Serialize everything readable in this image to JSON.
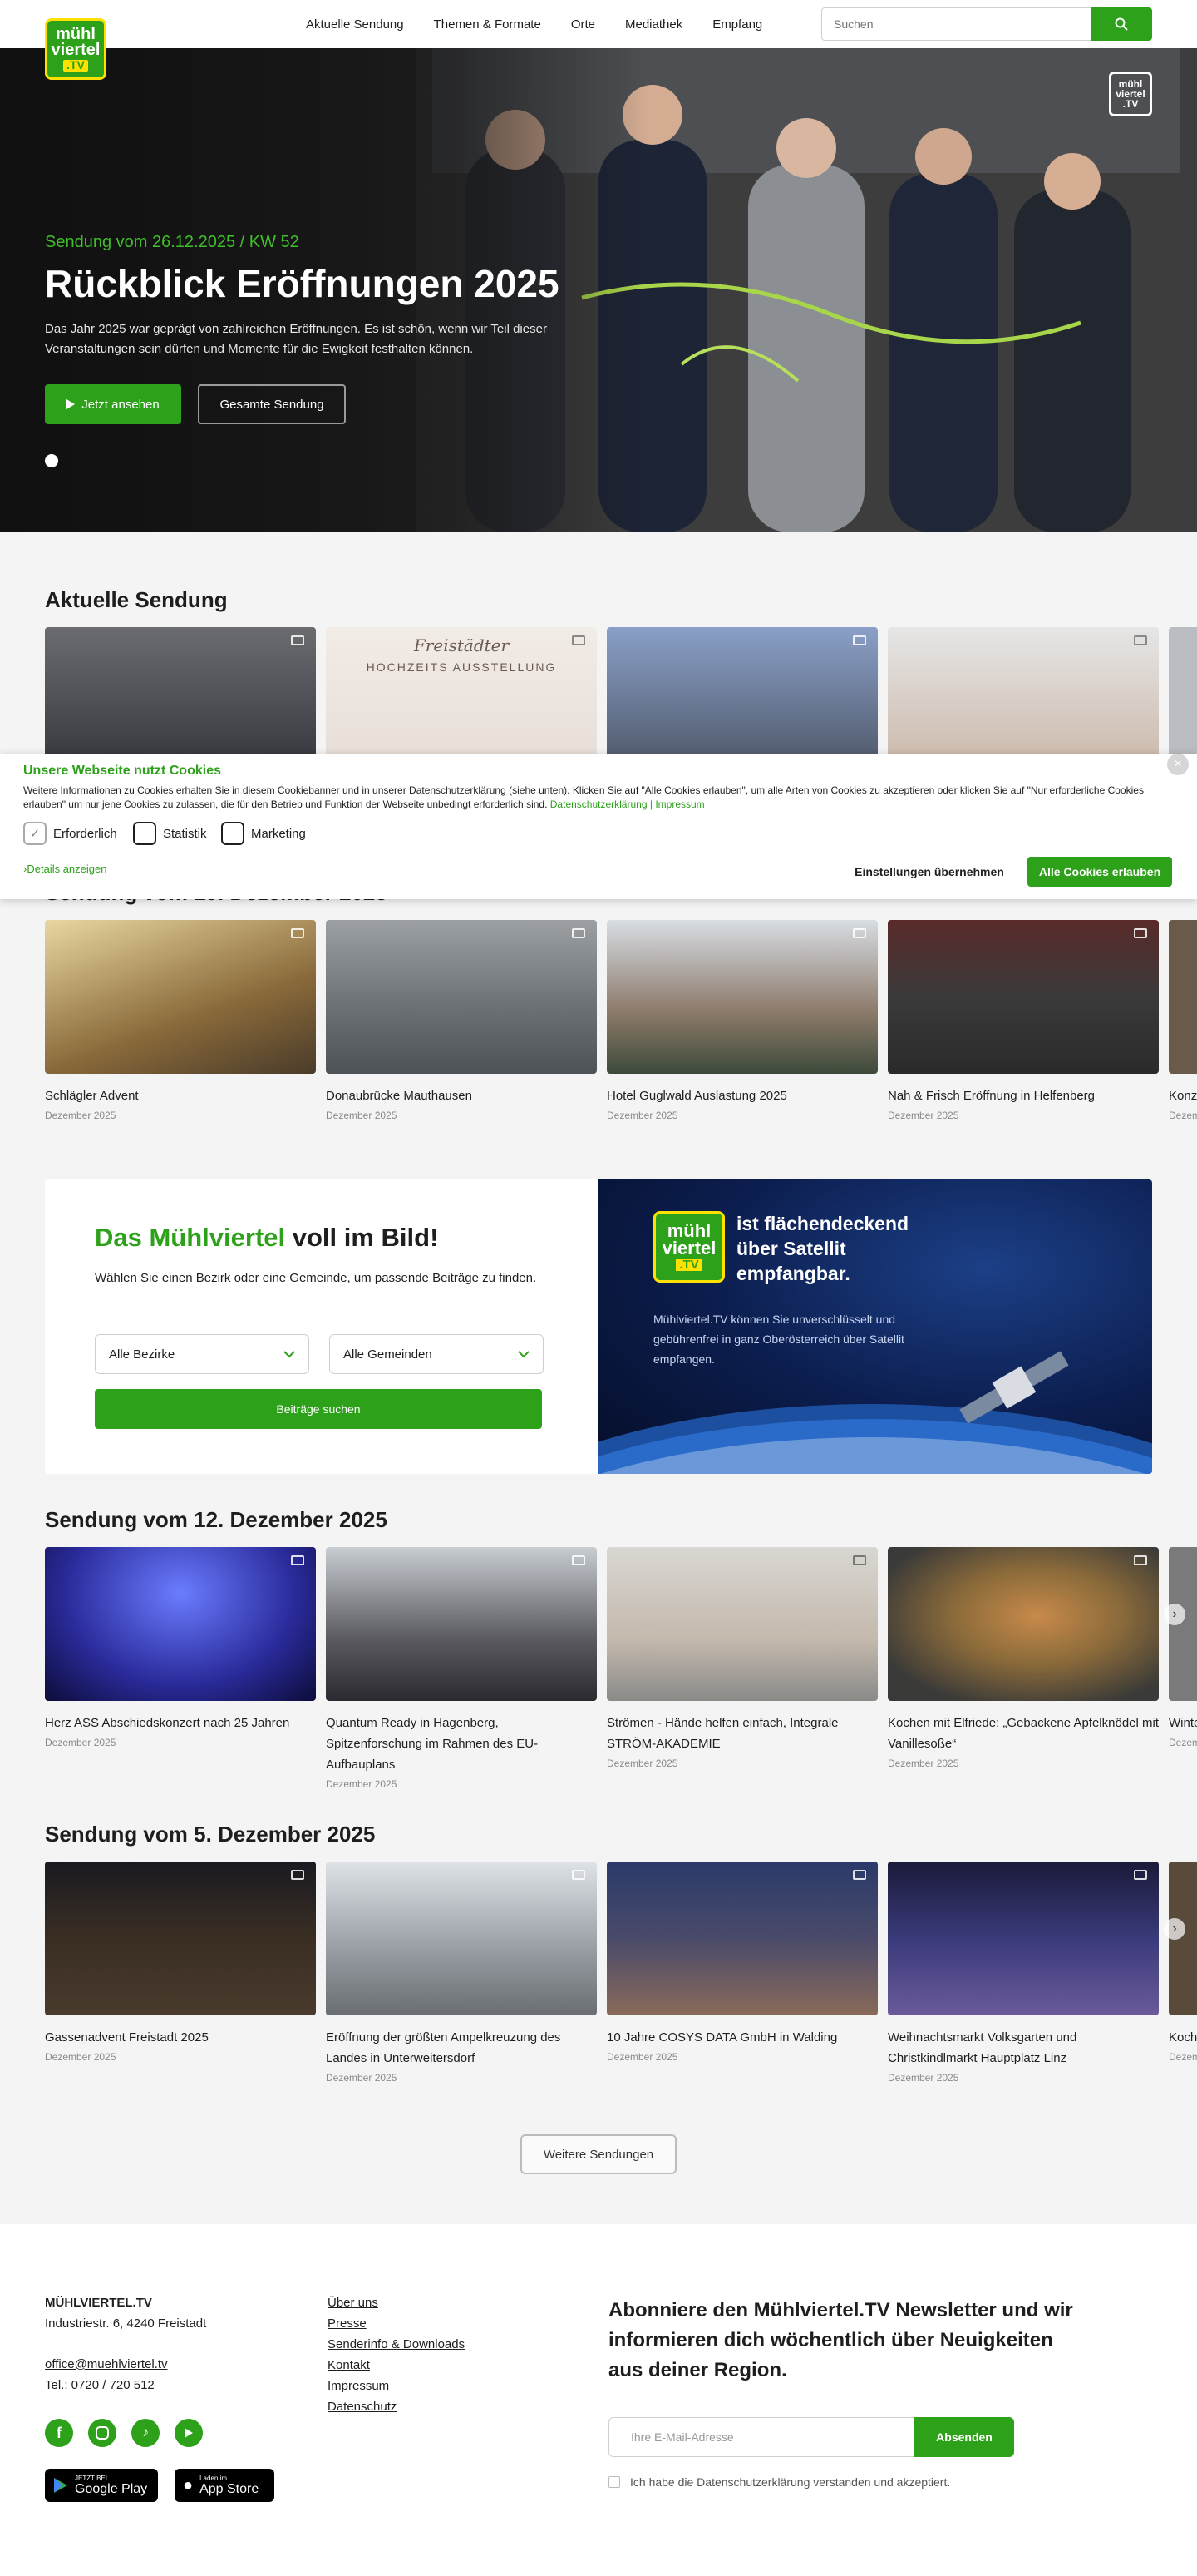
{
  "header": {
    "logo": {
      "line1": "mühl",
      "line2": "viertel",
      "line3": ".TV"
    },
    "nav": [
      "Aktuelle Sendung",
      "Themen & Formate",
      "Orte",
      "Mediathek",
      "Empfang"
    ],
    "search_placeholder": "Suchen"
  },
  "hero": {
    "kicker": "Sendung vom 26.12.2025 / KW 52",
    "title": "Rückblick Eröffnungen 2025",
    "text": "Das Jahr 2025 war geprägt von zahlreichen Eröffnungen. Es ist schön, wenn wir Teil dieser Veranstaltungen sein dürfen und Momente für die Ewigkeit festhalten können.",
    "btn_watch": "Jetzt ansehen",
    "btn_full": "Gesamte Sendung",
    "badge": {
      "line1": "mühl",
      "line2": "viertel",
      "line3": ".TV"
    }
  },
  "current": {
    "title": "Aktuelle Sendung",
    "thumb_text": {
      "line1": "Freistädter",
      "line2": "HOCHZEITS AUSSTELLUNG"
    }
  },
  "cookie": {
    "title": "Unsere Webseite nutzt Cookies",
    "text": "Weitere Informationen zu Cookies erhalten Sie in diesem Cookiebanner und in unserer Datenschutzerklärung (siehe unten). Klicken Sie auf \"Alle Cookies erlauben\", um alle Arten von Cookies zu akzeptieren oder klicken Sie auf \"Nur erforderliche Cookies erlauben\" um nur jene Cookies zu zulassen, die für den Betrieb und Funktion der Webseite unbedingt erforderlich sind.",
    "link_privacy": "Datenschutzerklärung",
    "link_sep": "|",
    "link_imprint": "Impressum",
    "options": [
      "Erforderlich",
      "Statistik",
      "Marketing"
    ],
    "details": "Details anzeigen",
    "save": "Einstellungen übernehmen",
    "allow_all": "Alle Cookies erlauben",
    "close": "×"
  },
  "section1": {
    "title": "Sendung vom 19. Dezember 2025",
    "items": [
      {
        "title": "Schlägler Advent",
        "date": "Dezember 2025"
      },
      {
        "title": "Donaubrücke Mauthausen",
        "date": "Dezember 2025"
      },
      {
        "title": "Hotel Guglwald Auslastung 2025",
        "date": "Dezember 2025"
      },
      {
        "title": "Nah & Frisch Eröffnung in Helfenberg",
        "date": "Dezember 2025"
      },
      {
        "title": "Konze… St. M…",
        "date": "Dezem…"
      }
    ]
  },
  "promo": {
    "title_green": "Das Mühlviertel",
    "title_rest": " voll im Bild!",
    "text": "Wählen Sie einen Bezirk oder eine Gemeinde, um passende Beiträge zu finden.",
    "select_district": "Alle Bezirke",
    "select_community": "Alle Gemeinden",
    "button": "Beiträge suchen",
    "sat_title": "ist flächendeckend über Satellit empfangbar.",
    "sat_text": "Mühlviertel.TV können Sie unverschlüsselt und gebührenfrei in ganz Oberösterreich über Satellit empfangen.",
    "sat_logo": {
      "line1": "mühl",
      "line2": "viertel",
      "line3": ".TV"
    }
  },
  "section2": {
    "title": "Sendung vom 12. Dezember 2025",
    "items": [
      {
        "title": "Herz ASS Abschiedskonzert nach 25 Jahren",
        "date": "Dezember 2025"
      },
      {
        "title": "Quantum Ready in Hagenberg, Spitzenforschung im Rahmen des EU-Aufbauplans",
        "date": "Dezember 2025"
      },
      {
        "title": "Strömen - Hände helfen einfach, Integrale STRÖM-AKADEMIE",
        "date": "Dezember 2025"
      },
      {
        "title": "Kochen mit Elfriede: „Gebackene Apfelknödel mit Vanillesoße“",
        "date": "Dezember 2025"
      },
      {
        "title": "Winte… Kreat…",
        "date": "Dezem…"
      }
    ]
  },
  "section3": {
    "title": "Sendung vom 5. Dezember 2025",
    "items": [
      {
        "title": "Gassenadvent Freistadt 2025",
        "date": "Dezember 2025"
      },
      {
        "title": "Eröffnung der größten Ampelkreuzung des Landes in Unterweitersdorf",
        "date": "Dezember 2025"
      },
      {
        "title": "10 Jahre COSYS DATA GmbH in Walding",
        "date": "Dezember 2025"
      },
      {
        "title": "Weihnachtsmarkt Volksgarten und Christkindlmarkt Hauptplatz Linz",
        "date": "Dezember 2025"
      },
      {
        "title": "Koch… Blätt…",
        "date": "Dezem…"
      }
    ]
  },
  "more_button": "Weitere Sendungen",
  "footer": {
    "company": "MÜHLVIERTEL.TV",
    "address": "Industriestr. 6, 4240 Freistadt",
    "email": "office@muehlviertel.tv",
    "phone": "Tel.: 0720 / 720 512",
    "links": [
      "Über uns",
      "Presse",
      "Senderinfo & Downloads",
      "Kontakt",
      "Impressum",
      "Datenschutz"
    ],
    "store_google": {
      "small": "JETZT BEI",
      "big": "Google Play"
    },
    "store_apple": {
      "small": "Laden im",
      "big": "App Store"
    },
    "newsletter_title": "Abonniere den Mühlviertel.TV Newsletter und wir informieren dich wöchentlich über Neuigkeiten aus deiner Region.",
    "newsletter_placeholder": "Ihre E-Mail-Adresse",
    "newsletter_button": "Absenden",
    "newsletter_consent": "Ich habe die Datenschutzerklärung verstanden und akzeptiert."
  },
  "colors": {
    "accent": "#2ea11b",
    "logo_yellow": "#ffe100"
  }
}
